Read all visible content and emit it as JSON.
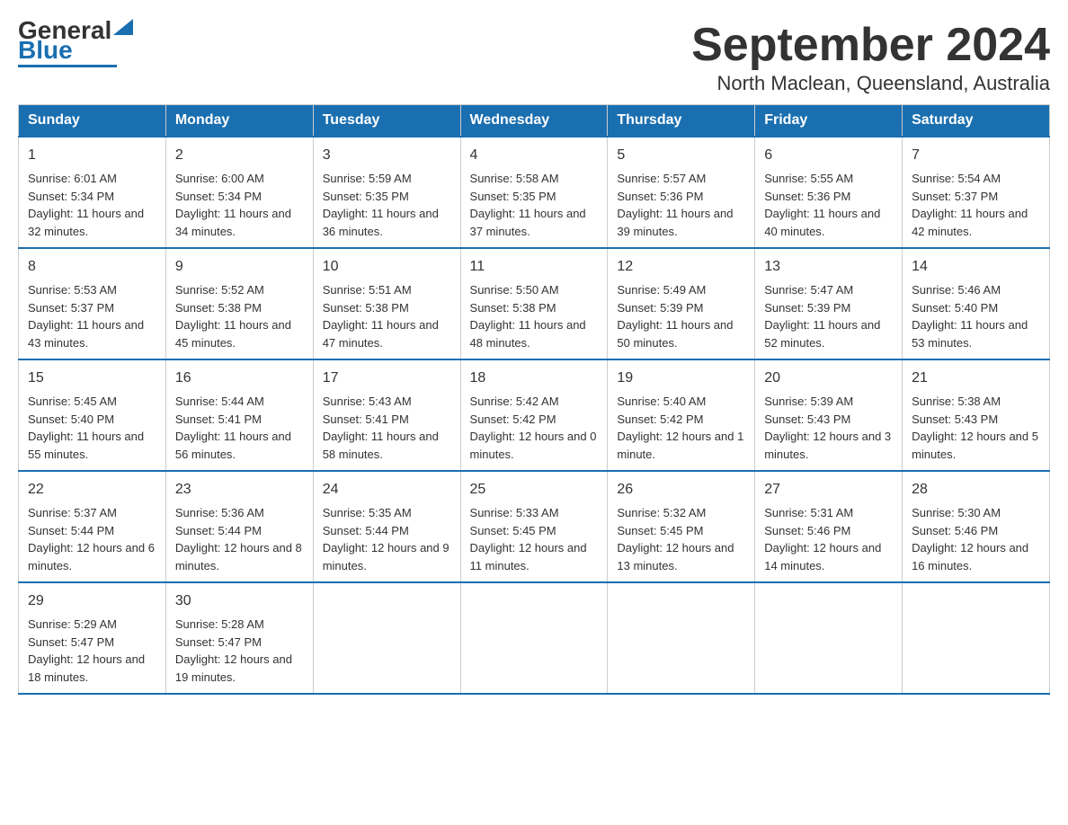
{
  "logo": {
    "text_general": "General",
    "text_blue": "Blue"
  },
  "title": {
    "month_year": "September 2024",
    "location": "North Maclean, Queensland, Australia"
  },
  "weekdays": [
    "Sunday",
    "Monday",
    "Tuesday",
    "Wednesday",
    "Thursday",
    "Friday",
    "Saturday"
  ],
  "weeks": [
    [
      {
        "day": "1",
        "sunrise": "6:01 AM",
        "sunset": "5:34 PM",
        "daylight": "11 hours and 32 minutes."
      },
      {
        "day": "2",
        "sunrise": "6:00 AM",
        "sunset": "5:34 PM",
        "daylight": "11 hours and 34 minutes."
      },
      {
        "day": "3",
        "sunrise": "5:59 AM",
        "sunset": "5:35 PM",
        "daylight": "11 hours and 36 minutes."
      },
      {
        "day": "4",
        "sunrise": "5:58 AM",
        "sunset": "5:35 PM",
        "daylight": "11 hours and 37 minutes."
      },
      {
        "day": "5",
        "sunrise": "5:57 AM",
        "sunset": "5:36 PM",
        "daylight": "11 hours and 39 minutes."
      },
      {
        "day": "6",
        "sunrise": "5:55 AM",
        "sunset": "5:36 PM",
        "daylight": "11 hours and 40 minutes."
      },
      {
        "day": "7",
        "sunrise": "5:54 AM",
        "sunset": "5:37 PM",
        "daylight": "11 hours and 42 minutes."
      }
    ],
    [
      {
        "day": "8",
        "sunrise": "5:53 AM",
        "sunset": "5:37 PM",
        "daylight": "11 hours and 43 minutes."
      },
      {
        "day": "9",
        "sunrise": "5:52 AM",
        "sunset": "5:38 PM",
        "daylight": "11 hours and 45 minutes."
      },
      {
        "day": "10",
        "sunrise": "5:51 AM",
        "sunset": "5:38 PM",
        "daylight": "11 hours and 47 minutes."
      },
      {
        "day": "11",
        "sunrise": "5:50 AM",
        "sunset": "5:38 PM",
        "daylight": "11 hours and 48 minutes."
      },
      {
        "day": "12",
        "sunrise": "5:49 AM",
        "sunset": "5:39 PM",
        "daylight": "11 hours and 50 minutes."
      },
      {
        "day": "13",
        "sunrise": "5:47 AM",
        "sunset": "5:39 PM",
        "daylight": "11 hours and 52 minutes."
      },
      {
        "day": "14",
        "sunrise": "5:46 AM",
        "sunset": "5:40 PM",
        "daylight": "11 hours and 53 minutes."
      }
    ],
    [
      {
        "day": "15",
        "sunrise": "5:45 AM",
        "sunset": "5:40 PM",
        "daylight": "11 hours and 55 minutes."
      },
      {
        "day": "16",
        "sunrise": "5:44 AM",
        "sunset": "5:41 PM",
        "daylight": "11 hours and 56 minutes."
      },
      {
        "day": "17",
        "sunrise": "5:43 AM",
        "sunset": "5:41 PM",
        "daylight": "11 hours and 58 minutes."
      },
      {
        "day": "18",
        "sunrise": "5:42 AM",
        "sunset": "5:42 PM",
        "daylight": "12 hours and 0 minutes."
      },
      {
        "day": "19",
        "sunrise": "5:40 AM",
        "sunset": "5:42 PM",
        "daylight": "12 hours and 1 minute."
      },
      {
        "day": "20",
        "sunrise": "5:39 AM",
        "sunset": "5:43 PM",
        "daylight": "12 hours and 3 minutes."
      },
      {
        "day": "21",
        "sunrise": "5:38 AM",
        "sunset": "5:43 PM",
        "daylight": "12 hours and 5 minutes."
      }
    ],
    [
      {
        "day": "22",
        "sunrise": "5:37 AM",
        "sunset": "5:44 PM",
        "daylight": "12 hours and 6 minutes."
      },
      {
        "day": "23",
        "sunrise": "5:36 AM",
        "sunset": "5:44 PM",
        "daylight": "12 hours and 8 minutes."
      },
      {
        "day": "24",
        "sunrise": "5:35 AM",
        "sunset": "5:44 PM",
        "daylight": "12 hours and 9 minutes."
      },
      {
        "day": "25",
        "sunrise": "5:33 AM",
        "sunset": "5:45 PM",
        "daylight": "12 hours and 11 minutes."
      },
      {
        "day": "26",
        "sunrise": "5:32 AM",
        "sunset": "5:45 PM",
        "daylight": "12 hours and 13 minutes."
      },
      {
        "day": "27",
        "sunrise": "5:31 AM",
        "sunset": "5:46 PM",
        "daylight": "12 hours and 14 minutes."
      },
      {
        "day": "28",
        "sunrise": "5:30 AM",
        "sunset": "5:46 PM",
        "daylight": "12 hours and 16 minutes."
      }
    ],
    [
      {
        "day": "29",
        "sunrise": "5:29 AM",
        "sunset": "5:47 PM",
        "daylight": "12 hours and 18 minutes."
      },
      {
        "day": "30",
        "sunrise": "5:28 AM",
        "sunset": "5:47 PM",
        "daylight": "12 hours and 19 minutes."
      },
      null,
      null,
      null,
      null,
      null
    ]
  ]
}
